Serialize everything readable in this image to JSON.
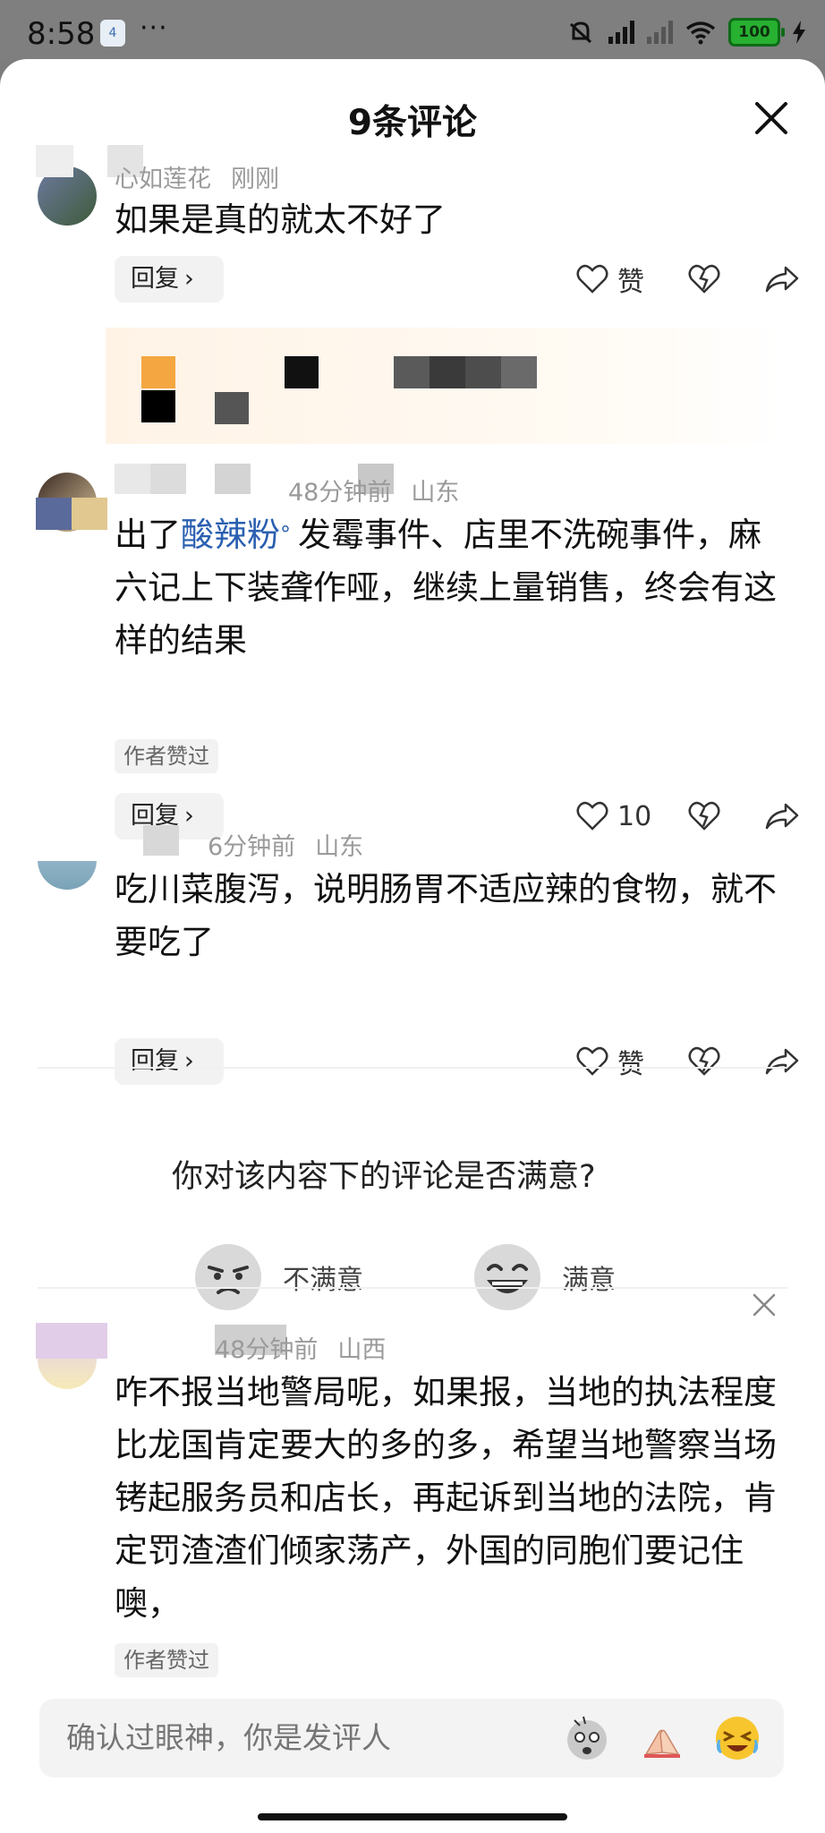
{
  "status": {
    "time": "8:58",
    "badge": "4",
    "dots": "···",
    "battery": "100"
  },
  "sheet": {
    "title": "9条评论"
  },
  "comments": [
    {
      "user": "心如莲花",
      "time": "刚刚",
      "location": "",
      "text": "如果是真的就太不好了",
      "reply_label": "回复",
      "like_label": "赞"
    },
    {
      "user": "",
      "time": "48分钟前",
      "location": "山东",
      "text_before": "出了",
      "topic": "酸辣粉",
      "text_after": "发霉事件、店里不洗碗事件，麻六记上下装聋作哑，继续上量销售，终会有这样的结果",
      "author_liked": "作者赞过",
      "reply_label": "回复",
      "like_label": "10"
    },
    {
      "user": "",
      "time": "6分钟前",
      "location": "山东",
      "text": "吃川菜腹泻，说明肠胃不适应辣的食物，就不要吃了",
      "reply_label": "回复",
      "like_label": "赞"
    },
    {
      "user": "",
      "time": "48分钟前",
      "location": "山西",
      "text": "咋不报当地警局呢，如果报，当地的执法程度比龙国肯定要大的多的多，希望当地警察当场铐起服务员和店长，再起诉到当地的法院，肯定罚渣渣们倾家荡产，外国的同胞们要记住噢，",
      "author_liked": "作者赞过"
    }
  ],
  "survey": {
    "question": "你对该内容下的评论是否满意?",
    "negative": "不满意",
    "positive": "满意"
  },
  "input": {
    "placeholder": "确认过眼神，你是发评人"
  },
  "colors": {
    "topic": "#2a5fb0",
    "battery": "#28b031",
    "ad_accent": "#f4a640"
  }
}
